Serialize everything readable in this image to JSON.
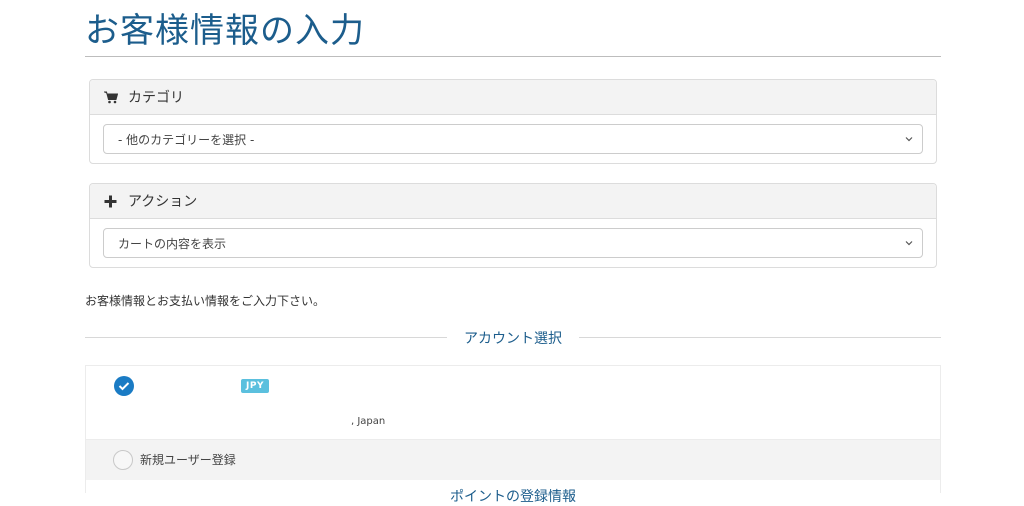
{
  "page": {
    "title": "お客様情報の入力"
  },
  "category_panel": {
    "heading": "カテゴリ",
    "icon": "cart-icon",
    "select_value": "- 他のカテゴリーを選択 -"
  },
  "action_panel": {
    "heading": "アクション",
    "icon": "plus-icon",
    "select_value": "カートの内容を表示"
  },
  "intro_text": "お客様情報とお支払い情報をご入力下さい。",
  "account_section": {
    "heading": "アカウント選択",
    "selected_account": {
      "currency_badge": "JPY",
      "address_line": ", Japan"
    },
    "new_user_label": "新規ユーザー登録"
  },
  "next_section_heading": "ポイントの登録情報",
  "colors": {
    "title": "#1c5d8c",
    "accent": "#1a7bc4",
    "badge": "#5bc0de"
  }
}
